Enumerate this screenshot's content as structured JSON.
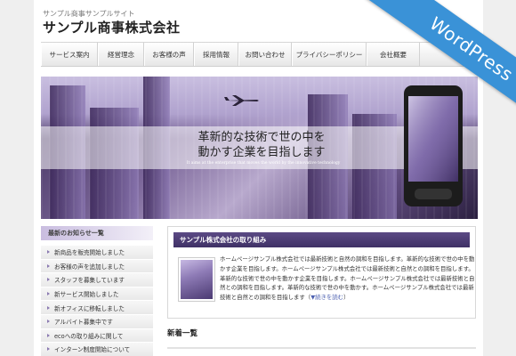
{
  "header": {
    "tagline": "サンプル商事サンプルサイト",
    "site_title": "サンプル商事株式会社"
  },
  "nav": {
    "items": [
      {
        "label": "サービス案内"
      },
      {
        "label": "経営理念"
      },
      {
        "label": "お客様の声"
      },
      {
        "label": "採用情報"
      },
      {
        "label": "お問い合わせ"
      },
      {
        "label": "プライバシーポリシー"
      },
      {
        "label": "会社概要"
      }
    ]
  },
  "hero": {
    "headline_line1": "革新的な技術で世の中を",
    "headline_line2": "動かす企業を目指します",
    "subline": "It aims at the enterprise that moves the world by the innovative technology"
  },
  "sidebar": {
    "title": "最新のお知らせ一覧",
    "items": [
      {
        "label": "新商品を販売開始しました"
      },
      {
        "label": "お客様の声を追加しました"
      },
      {
        "label": "スタッフを募集しています"
      },
      {
        "label": "新サービス開始しました"
      },
      {
        "label": "新オフィスに移転しました"
      },
      {
        "label": "アルバイト募集中です"
      },
      {
        "label": "ecoへの取り組みに関して"
      },
      {
        "label": "インターン制度開始について"
      }
    ]
  },
  "main": {
    "box_title": "サンプル株式会社の取り組み",
    "box_text": "ホームページサンプル株式会社では最新技術と自然の調和を目指します。革新的な技術で世の中を動かす企業を目指します。ホームページサンプル株式会社では最新技術と自然との調和を目指します。革新的な技術で世の中を動かす企業を目指します。ホームページサンプル株式会社では最新技術と自然との調和を目指します。革新的な技術で世の中を動かす。ホームページサンプル株式会社では最新技術と自然との調和を目指します（",
    "more_link": "▼続きを読む",
    "box_text_end": "）",
    "news_title": "新着一覧"
  },
  "ribbon": {
    "label": "WordPress"
  },
  "colors": {
    "accent": "#3a92d7",
    "box_title_bg": "#4a3b72",
    "sidebar_head": "#c9bde0"
  }
}
